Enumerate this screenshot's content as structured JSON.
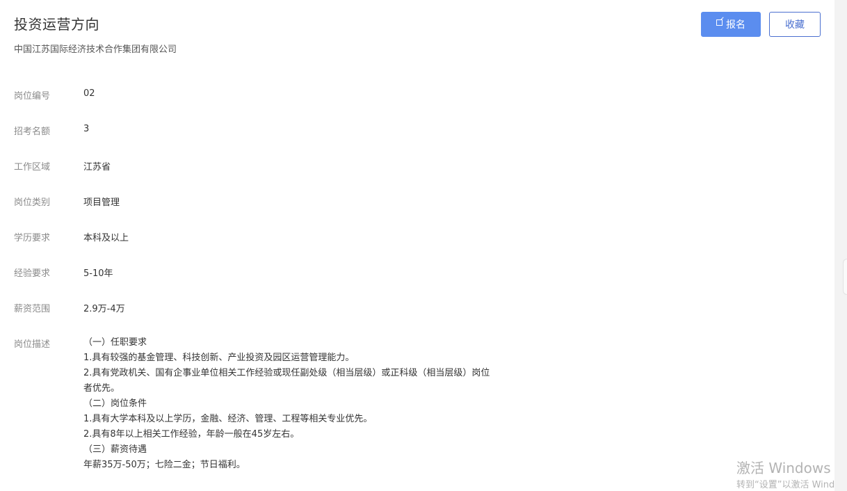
{
  "header": {
    "title": "投资运营方向",
    "company": "中国江苏国际经济技术合作集团有限公司",
    "apply_label": "报名",
    "favorite_label": "收藏"
  },
  "details": [
    {
      "label": "岗位编号",
      "value": "02"
    },
    {
      "label": "招考名额",
      "value": "3"
    },
    {
      "label": "工作区域",
      "value": "江苏省"
    },
    {
      "label": "岗位类别",
      "value": "项目管理"
    },
    {
      "label": "学历要求",
      "value": "本科及以上"
    },
    {
      "label": "经验要求",
      "value": "5-10年"
    },
    {
      "label": "薪资范围",
      "value": "2.9万-4万"
    }
  ],
  "description": {
    "label": "岗位描述",
    "lines": [
      "（一）任职要求",
      "1.具有较强的基金管理、科技创新、产业投资及园区运营管理能力。",
      "2.具有党政机关、国有企事业单位相关工作经验或现任副处级（相当层级）或正科级（相当层级）岗位",
      "者优先。",
      "（二）岗位条件",
      "1.具有大学本科及以上学历，金融、经济、管理、工程等相关专业优先。",
      "2.具有8年以上相关工作经验，年龄一般在45岁左右。",
      "（三）薪资待遇",
      "年薪35万-50万；七险二金；节日福利。"
    ]
  },
  "watermark": {
    "title": "激活 Windows",
    "subtitle": "转到“设置”以激活 Wind"
  },
  "colors": {
    "accent": "#5b8def",
    "outline": "#4a6fcf"
  }
}
